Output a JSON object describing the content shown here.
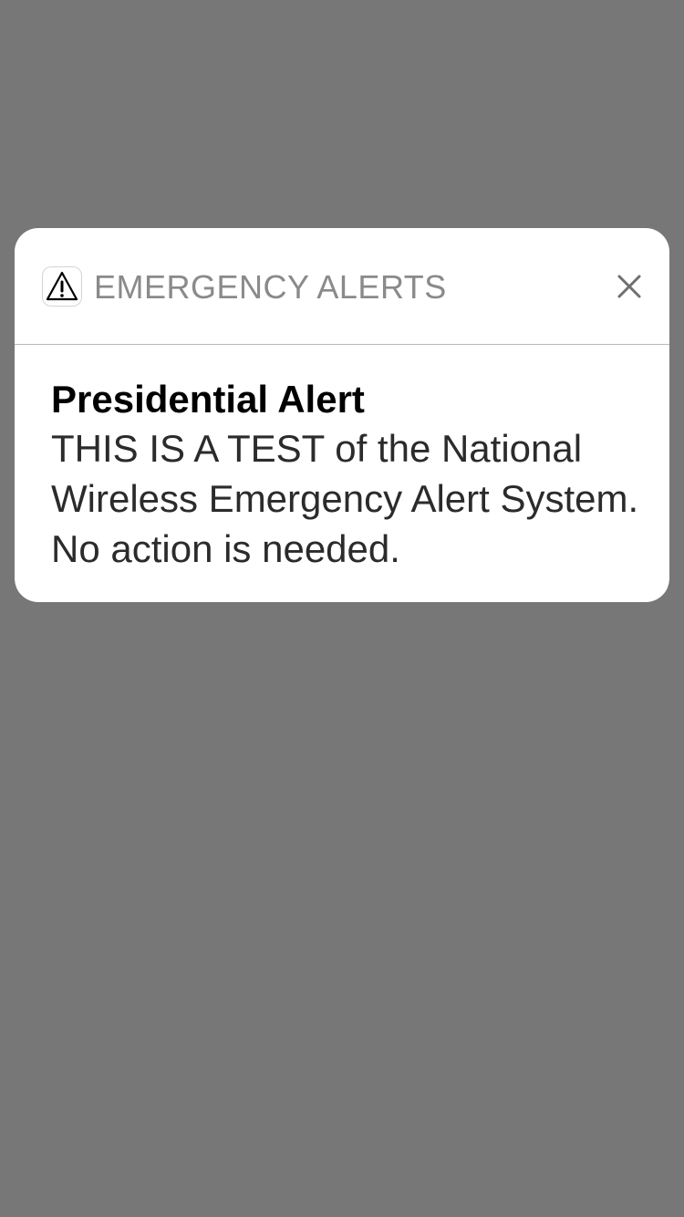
{
  "notification": {
    "app_icon": "warning-triangle-icon",
    "app_name": "EMERGENCY ALERTS",
    "close_icon": "close-icon",
    "title": "Presidential Alert",
    "message": "THIS IS A TEST of the National Wireless Emergency Alert System. No action is needed."
  },
  "colors": {
    "backdrop": "#777777",
    "card": "#ffffff",
    "app_name_text": "#8a8a8a",
    "title_text": "#000000",
    "message_text": "#2b2b2b"
  }
}
